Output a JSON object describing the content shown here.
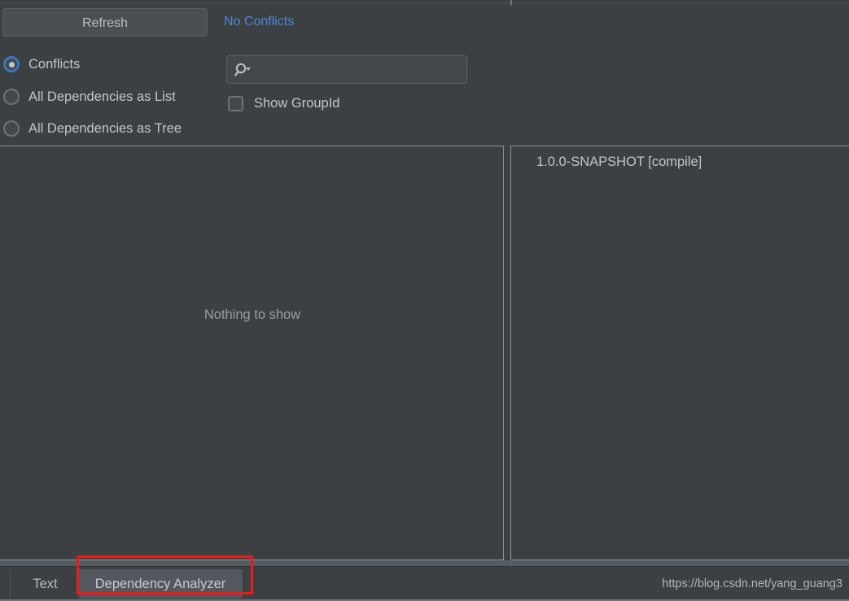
{
  "toolbar": {
    "refresh_label": "Refresh",
    "status_label": "No Conflicts",
    "status_color": "#4a88d8",
    "search": {
      "value": "",
      "placeholder": "",
      "icon": "search-icon-with-dropdown"
    },
    "view_options": [
      {
        "label": "Conflicts",
        "selected": true
      },
      {
        "label": "All Dependencies as List",
        "selected": false
      },
      {
        "label": "All Dependencies as Tree",
        "selected": false
      }
    ],
    "show_groupid": {
      "label": "Show GroupId",
      "checked": false
    }
  },
  "panels": {
    "left": {
      "empty_message": "Nothing to show"
    },
    "right": {
      "items": [
        {
          "label": "1.0.0-SNAPSHOT [compile]"
        }
      ]
    }
  },
  "bottom": {
    "tabs": [
      {
        "label": "Text",
        "selected": false
      },
      {
        "label": "Dependency Analyzer",
        "selected": true
      }
    ],
    "watermark": "https://blog.csdn.net/yang_guang3"
  },
  "annotation": {
    "color": "#ef1a1a",
    "target": "Dependency Analyzer"
  }
}
